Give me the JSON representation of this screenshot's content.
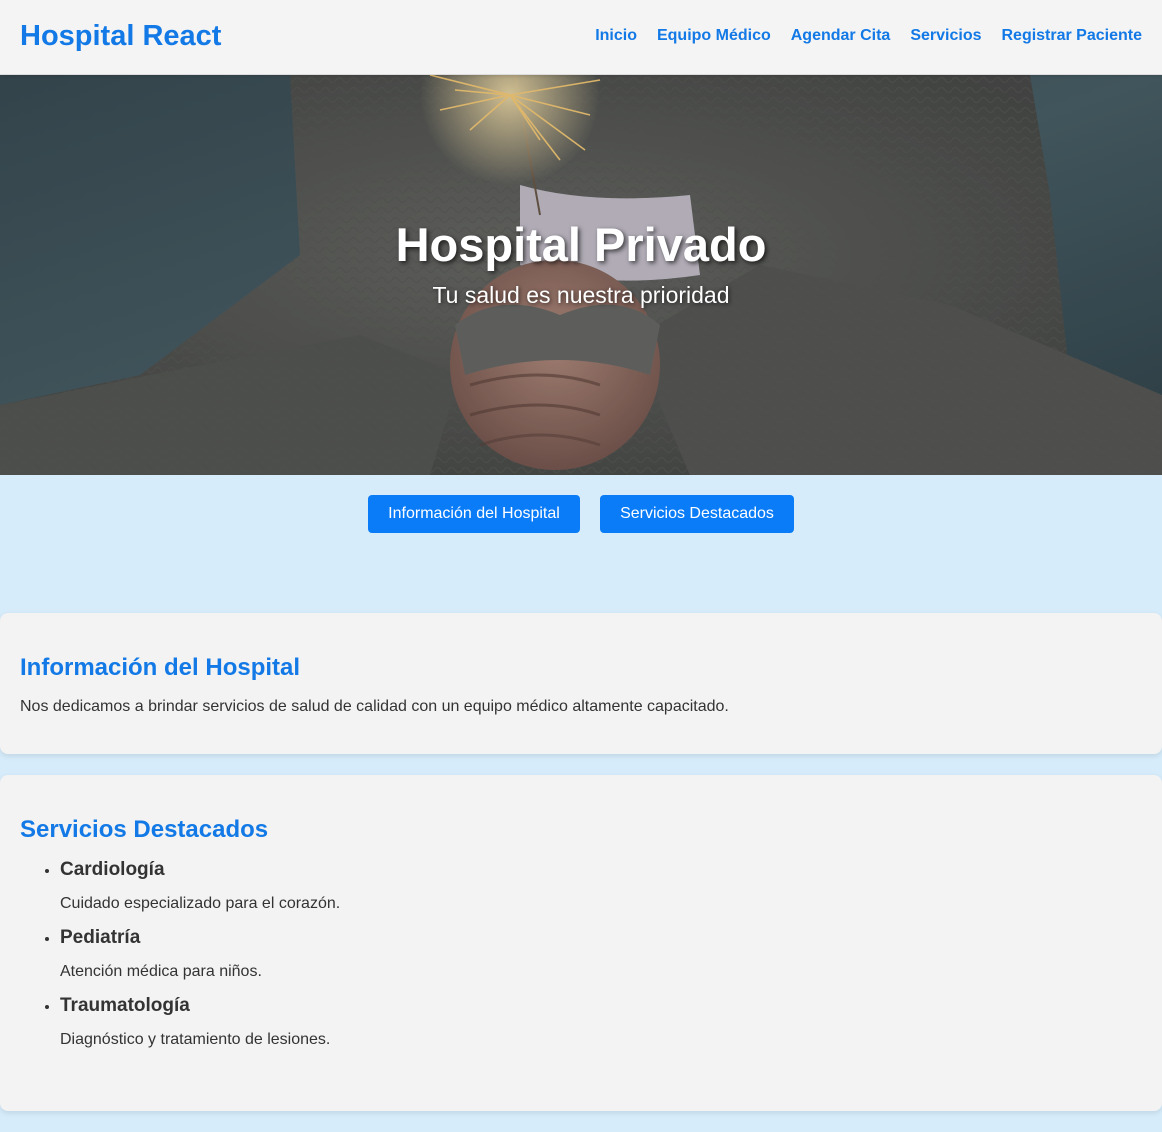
{
  "navbar": {
    "brand": "Hospital React",
    "links": [
      "Inicio",
      "Equipo Médico",
      "Agendar Cita",
      "Servicios",
      "Registrar Paciente"
    ]
  },
  "hero": {
    "title": "Hospital Privado",
    "subtitle": "Tu salud es nuestra prioridad"
  },
  "buttons": {
    "info": "Información del Hospital",
    "services": "Servicios Destacados"
  },
  "info_section": {
    "title": "Información del Hospital",
    "text": "Nos dedicamos a brindar servicios de salud de calidad con un equipo médico altamente capacitado."
  },
  "services_section": {
    "title": "Servicios Destacados",
    "items": [
      {
        "name": "Cardiología",
        "description": "Cuidado especializado para el corazón."
      },
      {
        "name": "Pediatría",
        "description": "Atención médica para niños."
      },
      {
        "name": "Traumatología",
        "description": "Diagnóstico y tratamiento de lesiones."
      }
    ]
  },
  "colors": {
    "accent": "#1279e6",
    "button": "#0a7cf7",
    "page_background": "#d6ecfb",
    "card_background": "#f3f3f3"
  }
}
